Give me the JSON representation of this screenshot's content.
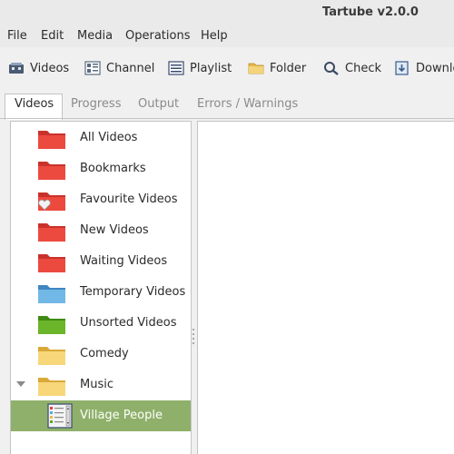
{
  "window": {
    "title": "Tartube v2.0.0"
  },
  "menu": [
    "File",
    "Edit",
    "Media",
    "Operations",
    "Help"
  ],
  "toolbar": [
    {
      "label": "Videos",
      "icon": "videos-icon"
    },
    {
      "label": "Channel",
      "icon": "channel-icon"
    },
    {
      "label": "Playlist",
      "icon": "playlist-icon"
    },
    {
      "label": "Folder",
      "icon": "folder-icon"
    },
    {
      "label": "Check",
      "icon": "check-icon"
    },
    {
      "label": "Download",
      "icon": "download-icon"
    }
  ],
  "tabs": [
    "Videos",
    "Progress",
    "Output",
    "Errors / Warnings"
  ],
  "active_tab": "Videos",
  "tree": [
    {
      "label": "All Videos",
      "icon": "red-folder-icon",
      "color": "#e8473f"
    },
    {
      "label": "Bookmarks",
      "icon": "red-folder-icon",
      "color": "#e8473f"
    },
    {
      "label": "Favourite Videos",
      "icon": "red-folder-heart-icon",
      "color": "#e8473f"
    },
    {
      "label": "New Videos",
      "icon": "red-folder-icon",
      "color": "#e8473f"
    },
    {
      "label": "Waiting Videos",
      "icon": "red-folder-icon",
      "color": "#e8473f"
    },
    {
      "label": "Temporary Videos",
      "icon": "blue-folder-icon",
      "color": "#5aa7dc"
    },
    {
      "label": "Unsorted Videos",
      "icon": "green-folder-icon",
      "color": "#5fa822"
    },
    {
      "label": "Comedy",
      "icon": "yellow-folder-icon",
      "color": "#f6d26b"
    },
    {
      "label": "Music",
      "icon": "yellow-folder-icon",
      "color": "#f6d26b",
      "expanded": true
    },
    {
      "label": "Village People",
      "icon": "playlist-icon",
      "selected": true
    }
  ],
  "colors": {
    "selection": "#8fb06a"
  }
}
